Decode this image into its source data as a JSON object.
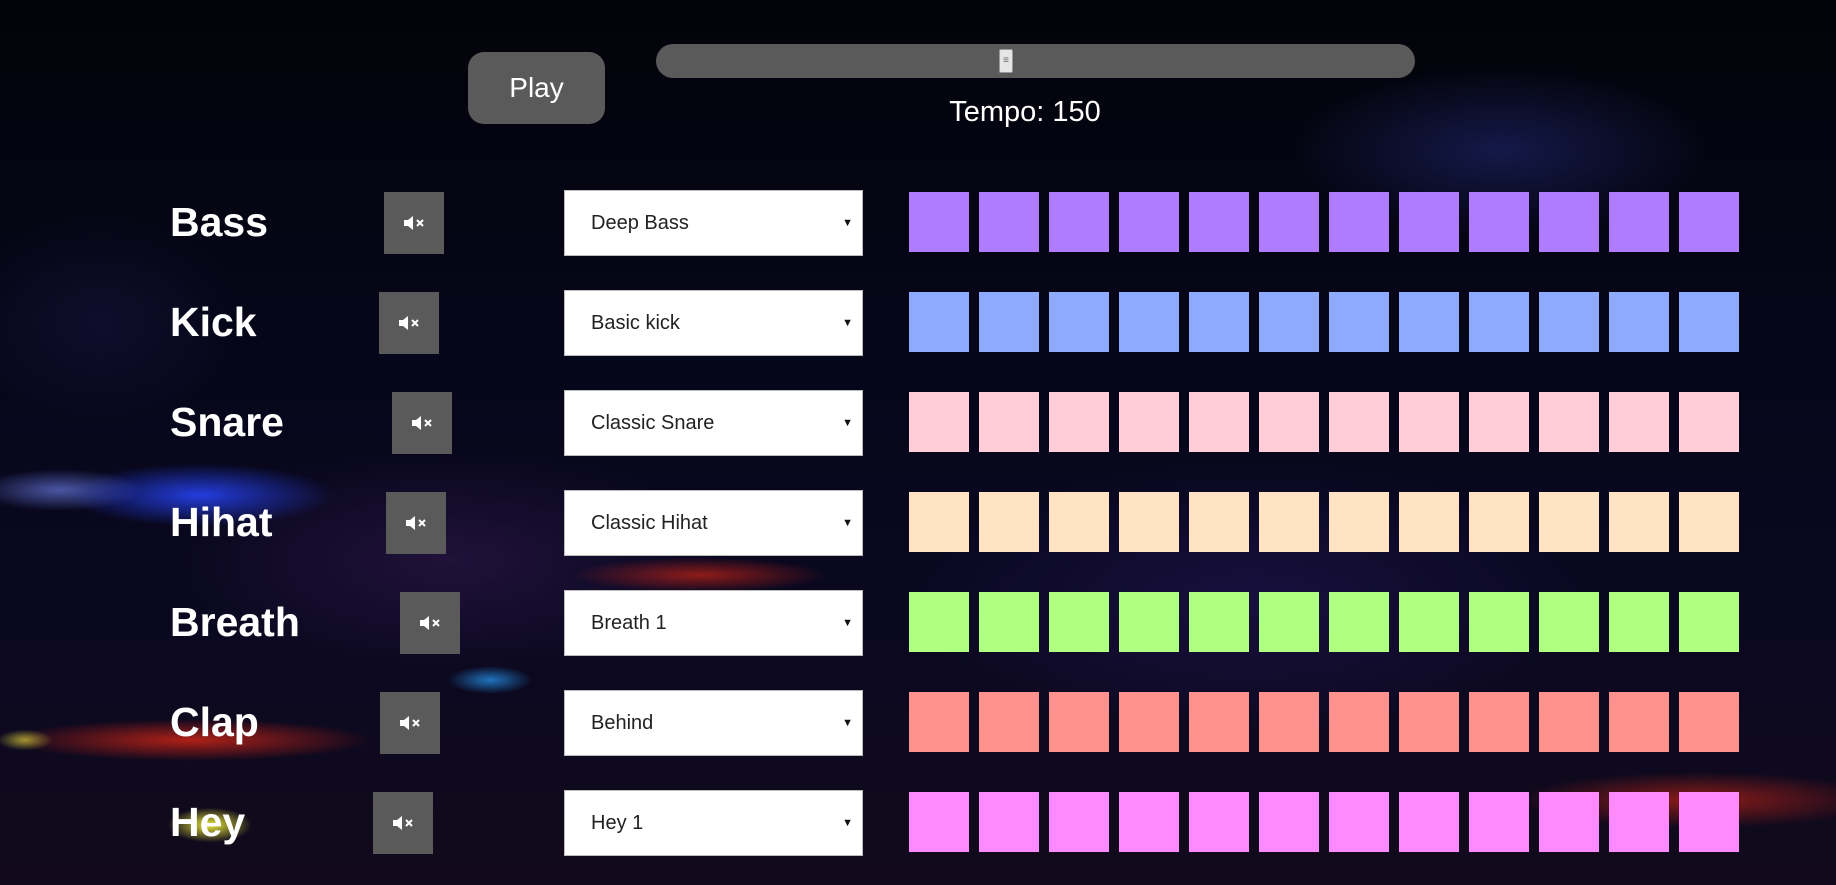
{
  "controls": {
    "play_label": "Play",
    "tempo_label": "Tempo: 150",
    "tempo_fraction": 0.46
  },
  "tracks": [
    {
      "name": "Bass",
      "sound": "Deep Bass",
      "color": "#b07cff"
    },
    {
      "name": "Kick",
      "sound": "Basic kick",
      "color": "#8eaaff"
    },
    {
      "name": "Snare",
      "sound": "Classic Snare",
      "color": "#ffccd8"
    },
    {
      "name": "Hihat",
      "sound": "Classic Hihat",
      "color": "#ffe3c2"
    },
    {
      "name": "Breath",
      "sound": "Breath 1",
      "color": "#afff80"
    },
    {
      "name": "Clap",
      "sound": "Behind",
      "color": "#ff928c"
    },
    {
      "name": "Hey",
      "sound": "Hey 1",
      "color": "#ff8aff"
    }
  ],
  "steps": 12,
  "icons": {
    "mute": "mute-icon",
    "dropdown": "chevron-down-icon"
  }
}
